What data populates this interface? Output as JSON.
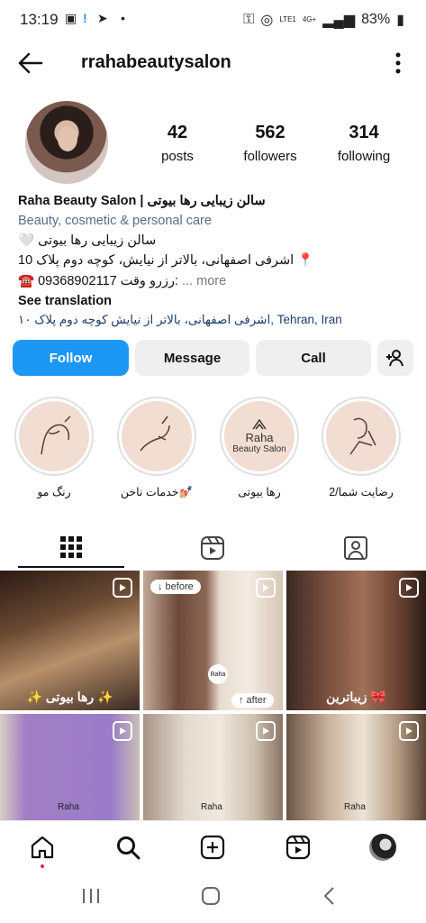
{
  "status": {
    "time": "13:19",
    "battery": "83%",
    "net": "LTE1",
    "net2": "4G+"
  },
  "header": {
    "username": "rrahabeautysalon"
  },
  "stats": [
    {
      "num": "42",
      "label": "posts"
    },
    {
      "num": "562",
      "label": "followers"
    },
    {
      "num": "314",
      "label": "following"
    }
  ],
  "bio": {
    "name": "Raha Beauty Salon | سالن زیبایی رها بیوتی",
    "category": "Beauty, cosmetic & personal care",
    "line1": "🤍 سالن زیبایی رها بیوتی",
    "line2": "اشرفی اصفهانی، بالاتر از نیایش، کوچه دوم پلاک 10 📍",
    "line3_phone": "☎️ 09368902117 رزرو وقت:",
    "line3_more": "... more",
    "translation": "See translation",
    "location": "اشرفی اصفهانی، بالاتر از نیایش کوچه دوم پلاک ۱۰,",
    "location_city": "Tehran, Iran"
  },
  "buttons": {
    "follow": "Follow",
    "message": "Message",
    "call": "Call"
  },
  "highlights": [
    {
      "label": "رنگ مو"
    },
    {
      "label": "خدمات ناخن💅🏼"
    },
    {
      "label": "رها بیوتی",
      "logo_title": "Raha",
      "logo_sub": "Beauty Salon"
    },
    {
      "label": "رضایت شما/2"
    }
  ],
  "grid": {
    "cap1": "✨ رها بیوتی ✨",
    "before": "↓ before",
    "after": "↑ after",
    "cap3": "زیباترین 🎀",
    "logo": "Raha"
  },
  "colors": {
    "primary": "#1c97f3",
    "button_bg": "#efefef",
    "highlight_bg": "#f2ddd3"
  },
  "icons": [
    "back-arrow-icon",
    "more-vertical-icon",
    "add-person-icon",
    "grid-icon",
    "reels-icon",
    "tagged-icon",
    "home-icon",
    "search-icon",
    "create-icon",
    "reels-nav-icon"
  ]
}
